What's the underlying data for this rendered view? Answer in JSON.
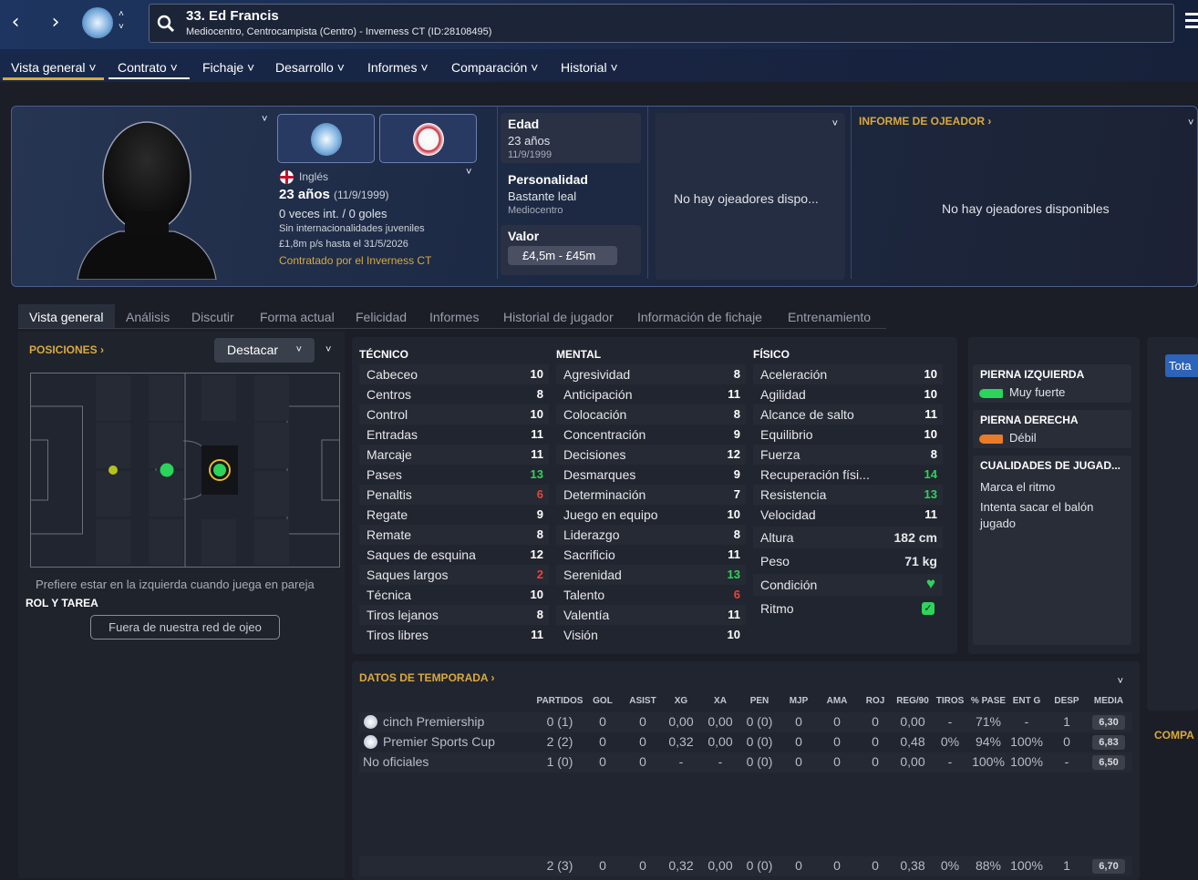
{
  "player": {
    "name": "33. Ed Francis",
    "subtitle": "Mediocentro, Centrocampista (Centro) - Inverness CT (ID:28108495)"
  },
  "menu": [
    "Vista general",
    "Contrato",
    "Fichaje",
    "Desarrollo",
    "Informes",
    "Comparación",
    "Historial"
  ],
  "profile": {
    "nationality": "Inglés",
    "age_line": "23 años",
    "dob": "(11/9/1999)",
    "intl": "0 veces int. / 0 goles",
    "youth": "Sin internacionalidades juveniles",
    "wage": "£1,8m p/s hasta el 31/5/2026",
    "contracted": "Contratado por el Inverness CT"
  },
  "boxes": {
    "age_label": "Edad",
    "age_value": "23 años",
    "age_dob": "11/9/1999",
    "pers_label": "Personalidad",
    "pers_value": "Bastante leal",
    "pers_pos": "Mediocentro",
    "value_label": "Valor",
    "value": "£4,5m - £45m",
    "scouts_short": "No hay ojeadores dispo...",
    "scout_report": "INFORME DE OJEADOR",
    "scouts_none": "No hay ojeadores disponibles"
  },
  "tabs": [
    "Vista general",
    "Análisis",
    "Discutir",
    "Forma actual",
    "Felicidad",
    "Informes",
    "Historial de jugador",
    "Información de fichaje",
    "Entrenamiento"
  ],
  "positions": {
    "title": "POSICIONES",
    "highlight": "Destacar",
    "pref": "Prefiere estar en la izquierda cuando juega en pareja",
    "role_title": "ROL Y TAREA",
    "scout_btn": "Fuera de nuestra red de ojeo"
  },
  "tecnico_title": "TÉCNICO",
  "mental_title": "MENTAL",
  "fisico_title": "FÍSICO",
  "tecnico": [
    [
      "Cabeceo",
      "10"
    ],
    [
      "Centros",
      "8"
    ],
    [
      "Control",
      "10"
    ],
    [
      "Entradas",
      "11"
    ],
    [
      "Marcaje",
      "11"
    ],
    [
      "Pases",
      "13"
    ],
    [
      "Penaltis",
      "6"
    ],
    [
      "Regate",
      "9"
    ],
    [
      "Remate",
      "8"
    ],
    [
      "Saques de esquina",
      "12"
    ],
    [
      "Saques largos",
      "2"
    ],
    [
      "Técnica",
      "10"
    ],
    [
      "Tiros lejanos",
      "8"
    ],
    [
      "Tiros libres",
      "11"
    ]
  ],
  "mental": [
    [
      "Agresividad",
      "8"
    ],
    [
      "Anticipación",
      "11"
    ],
    [
      "Colocación",
      "8"
    ],
    [
      "Concentración",
      "9"
    ],
    [
      "Decisiones",
      "12"
    ],
    [
      "Desmarques",
      "9"
    ],
    [
      "Determinación",
      "7"
    ],
    [
      "Juego en equipo",
      "10"
    ],
    [
      "Liderazgo",
      "8"
    ],
    [
      "Sacrificio",
      "11"
    ],
    [
      "Serenidad",
      "13"
    ],
    [
      "Talento",
      "6"
    ],
    [
      "Valentía",
      "11"
    ],
    [
      "Visión",
      "10"
    ]
  ],
  "fisico": [
    [
      "Aceleración",
      "10"
    ],
    [
      "Agilidad",
      "10"
    ],
    [
      "Alcance de salto",
      "11"
    ],
    [
      "Equilibrio",
      "10"
    ],
    [
      "Fuerza",
      "8"
    ],
    [
      "Recuperación físi...",
      "14"
    ],
    [
      "Resistencia",
      "13"
    ],
    [
      "Velocidad",
      "11"
    ]
  ],
  "physical_extra": {
    "altura_l": "Altura",
    "altura": "182 cm",
    "peso_l": "Peso",
    "peso": "71 kg",
    "condicion": "Condición",
    "ritmo": "Ritmo"
  },
  "feet": {
    "left_title": "PIERNA IZQUIERDA",
    "left": "Muy fuerte",
    "right_title": "PIERNA DERECHA",
    "right": "Débil",
    "qual_title": "CUALIDADES DE JUGAD...",
    "q1": "Marca el ritmo",
    "q2": "Intenta sacar el balón jugado"
  },
  "season": {
    "title": "DATOS DE TEMPORADA",
    "headers": [
      "PARTIDOS",
      "GOL",
      "ASIST",
      "XG",
      "XA",
      "PEN",
      "MJP",
      "AMA",
      "ROJ",
      "REG/90",
      "TIROS",
      "% PASE",
      "ENT G",
      "DESP",
      "MEDIA"
    ],
    "rows": [
      {
        "comp": "cinch Premiership",
        "vals": [
          "0 (1)",
          "0",
          "0",
          "0,00",
          "0,00",
          "0 (0)",
          "0",
          "0",
          "0",
          "0,00",
          "-",
          "71%",
          "-",
          "1",
          "6,30"
        ]
      },
      {
        "comp": "Premier Sports Cup",
        "vals": [
          "2 (2)",
          "0",
          "0",
          "0,32",
          "0,00",
          "0 (0)",
          "0",
          "0",
          "0",
          "0,48",
          "0%",
          "94%",
          "100%",
          "0",
          "6,83"
        ]
      },
      {
        "comp": "No oficiales",
        "vals": [
          "1 (0)",
          "0",
          "0",
          "-",
          "-",
          "0 (0)",
          "0",
          "0",
          "0",
          "0,00",
          "-",
          "100%",
          "100%",
          "-",
          "6,50"
        ]
      }
    ],
    "total": [
      "2 (3)",
      "0",
      "0",
      "0,32",
      "0,00",
      "0 (0)",
      "0",
      "0",
      "0",
      "0,38",
      "0%",
      "88%",
      "100%",
      "1",
      "6,70"
    ]
  },
  "right_btn": "Tota",
  "right_sec": "COMPA"
}
